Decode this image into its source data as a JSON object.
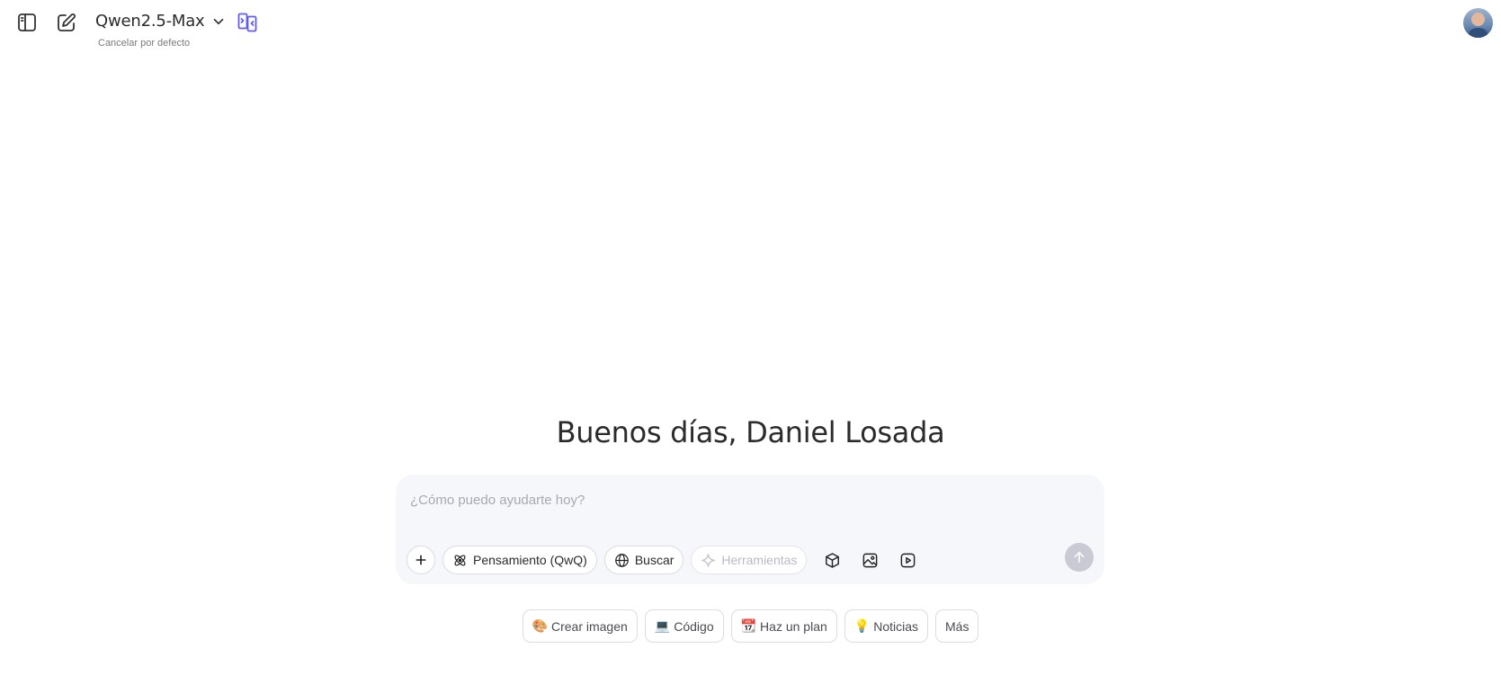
{
  "header": {
    "model_name": "Qwen2.5-Max",
    "model_subtitle": "Cancelar por defecto",
    "icons": {
      "sidebar": "sidebar-toggle-icon",
      "new_chat": "edit-icon",
      "model_dropdown": "chevron-down-icon",
      "compare": "split-screen-icon"
    },
    "accent_color": "#615ced"
  },
  "greeting": "Buenos días, Daniel Losada",
  "composer": {
    "placeholder": "¿Cómo puedo ayudarte hoy?",
    "value": "",
    "tools": [
      {
        "label": "Pensamiento (QwQ)",
        "icon": "atom-icon",
        "enabled": true
      },
      {
        "label": "Buscar",
        "icon": "globe-icon",
        "enabled": true
      },
      {
        "label": "Herramientas",
        "icon": "sparkle-icon",
        "enabled": false
      }
    ],
    "extra_icons": [
      "cube-icon",
      "image-icon",
      "video-icon"
    ],
    "send_icon": "arrow-up-icon"
  },
  "suggestions": [
    {
      "emoji": "🎨",
      "label": "Crear imagen"
    },
    {
      "emoji": "💻",
      "label": "Código"
    },
    {
      "emoji": "📆",
      "label": "Haz un plan"
    },
    {
      "emoji": "💡",
      "label": "Noticias"
    },
    {
      "emoji": "",
      "label": "Más"
    }
  ]
}
